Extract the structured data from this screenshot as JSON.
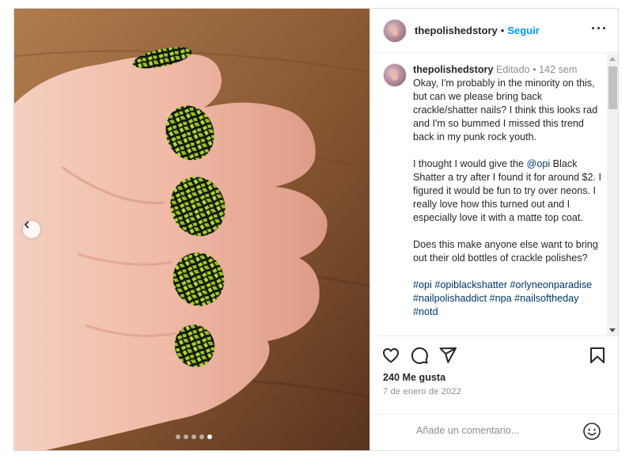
{
  "post": {
    "image_dots": {
      "count": 5,
      "active_index": 4
    }
  },
  "header": {
    "username": "thepolishedstory",
    "separator": "•",
    "follow_label": "Seguir",
    "more_label": "···"
  },
  "caption": {
    "username": "thepolishedstory",
    "edited_label": "Editado",
    "separator": "•",
    "age": "142 sem",
    "paragraph1": "Okay, I'm probably in the minority on this, but can we please bring back crackle/shatter nails? I think this looks rad and I'm so bummed I missed this trend back in my punk rock youth.",
    "paragraph2_before": "I thought I would give the ",
    "mention": "@opi",
    "paragraph2_after": " Black Shatter a try after I found it for around $2. I figured it would be fun to try over neons. I really love how this turned out and I especially love it with a matte top coat.",
    "paragraph3": "Does this make anyone else want to bring out their old bottles of crackle polishes?",
    "hashtags": [
      "#opi",
      "#opiblackshatter",
      "#orlyneonparadise",
      "#nailpolishaddict",
      "#npa",
      "#nailsoftheday",
      "#notd"
    ]
  },
  "actions": {
    "like_icon": "heart-icon",
    "comment_icon": "comment-icon",
    "share_icon": "paper-plane-icon",
    "save_icon": "bookmark-icon"
  },
  "likes_text": "240 Me gusta",
  "date_text": "7 de enero de 2022",
  "comment": {
    "placeholder": "Añade un comentario...",
    "emoji_icon": "smiley-icon"
  },
  "colors": {
    "link_blue": "#0095f6",
    "hashtag_blue": "#00376b",
    "nail_green": "#9cc72a",
    "crackle_black": "#14160e"
  }
}
